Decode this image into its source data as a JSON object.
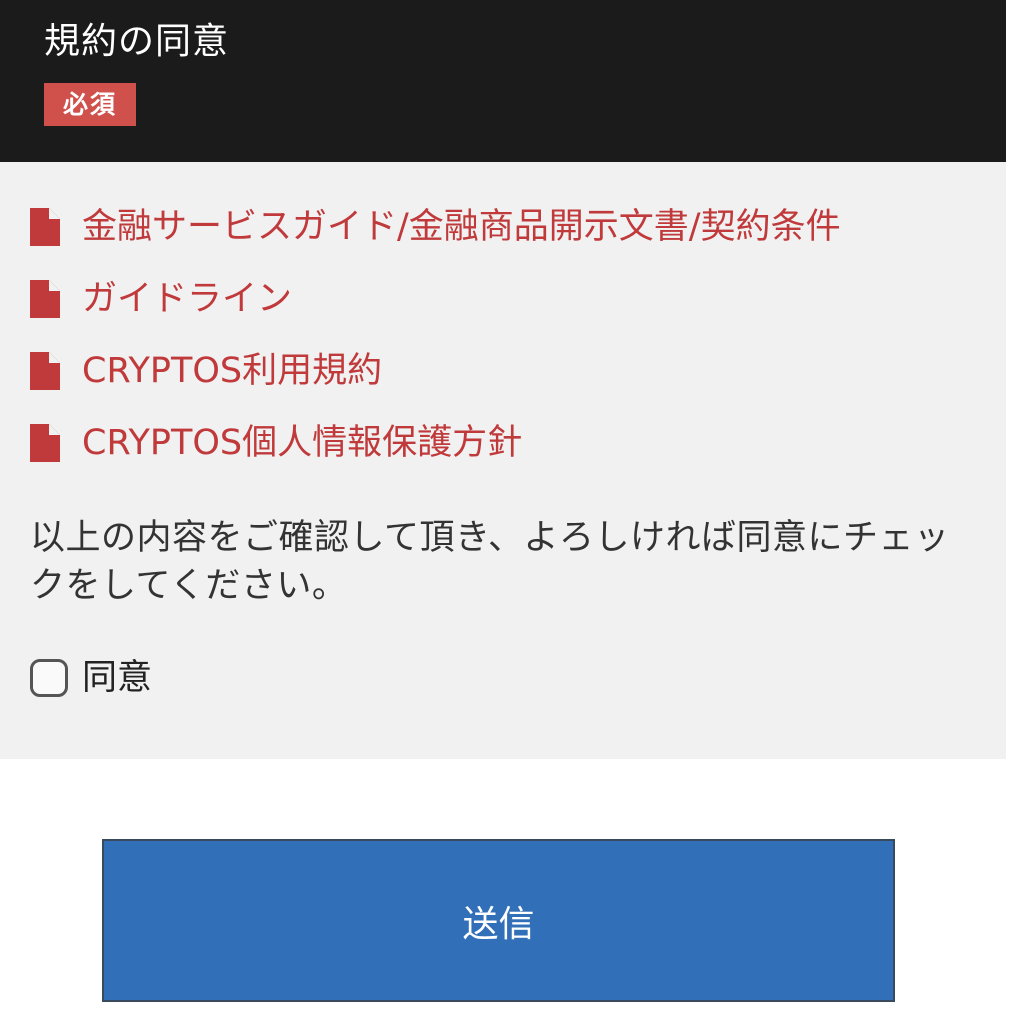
{
  "header": {
    "title": "規約の同意",
    "required_badge": "必須"
  },
  "documents": [
    {
      "label": "金融サービスガイド/金融商品開示文書/契約条件",
      "icon": "file-icon"
    },
    {
      "label": "ガイドライン",
      "icon": "file-icon"
    },
    {
      "label": "CRYPTOS利用規約",
      "icon": "file-icon"
    },
    {
      "label": "CRYPTOS個人情報保護方針",
      "icon": "file-icon"
    }
  ],
  "instruction": "以上の内容をご確認して頂き、よろしければ同意にチェックをしてください。",
  "agree": {
    "label": "同意",
    "checked": false
  },
  "submit": {
    "label": "送信"
  },
  "colors": {
    "header_bg": "#1b1b1b",
    "badge_bg": "#d0504c",
    "link": "#c0393b",
    "panel_bg": "#f1f1f1",
    "button_bg": "#3170b9"
  }
}
